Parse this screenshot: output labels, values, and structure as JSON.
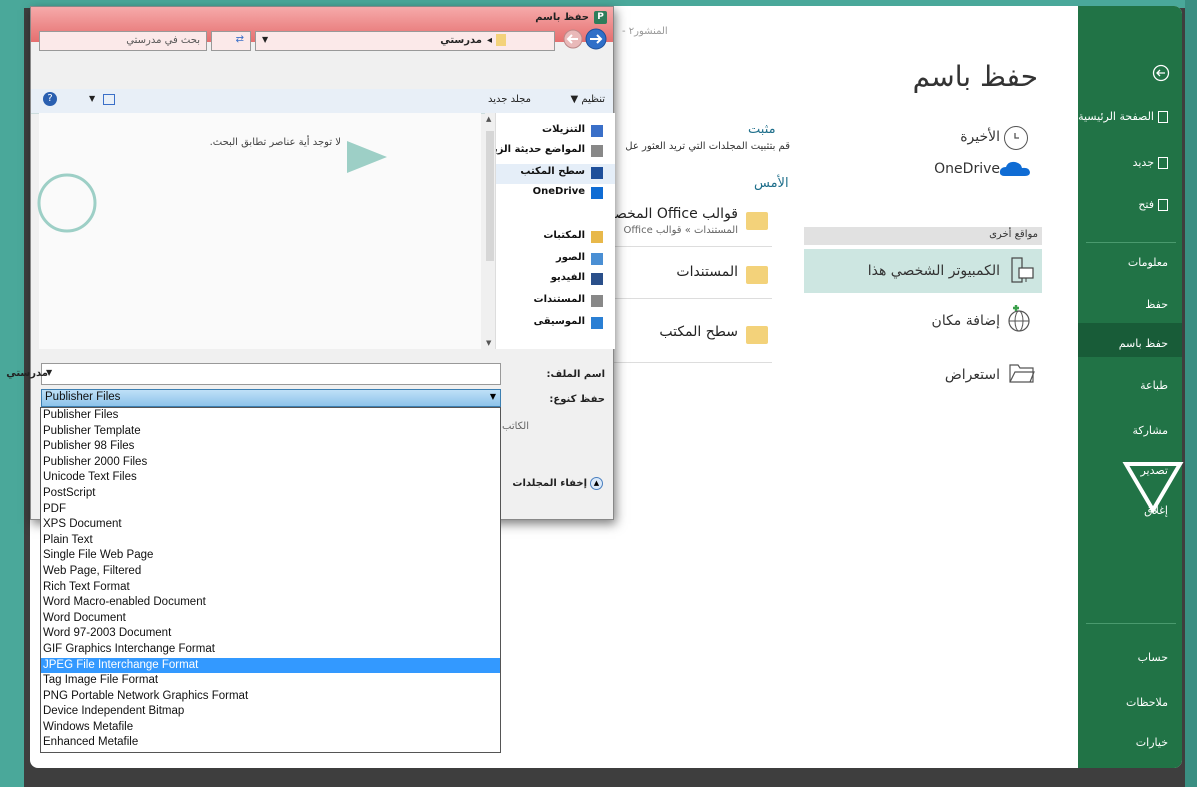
{
  "window": {
    "title_faint": "المنشور٢ -"
  },
  "backstage": {
    "back_icon": "back-arrow-icon",
    "items": [
      {
        "label": "الصفحة الرئيسية",
        "icon": "home-icon"
      },
      {
        "label": "جديد",
        "icon": "new-doc-icon"
      },
      {
        "label": "فتح",
        "icon": "open-folder-icon"
      },
      {
        "label": "معلومات"
      },
      {
        "label": "حفظ"
      },
      {
        "label": "حفظ باسم",
        "selected": true
      },
      {
        "label": "طباعة"
      },
      {
        "label": "مشاركة"
      },
      {
        "label": "تصدير"
      },
      {
        "label": "إغلاق"
      },
      {
        "label": "حساب"
      },
      {
        "label": "ملاحظات"
      },
      {
        "label": "خيارات"
      }
    ]
  },
  "saveas": {
    "title": "حفظ باسم",
    "locations": [
      {
        "label": "الأخيرة",
        "icon": "clock-icon"
      },
      {
        "label": "OneDrive",
        "icon": "onedrive-cloud-icon"
      }
    ],
    "other_locations_header": "مواقع أخرى",
    "other": [
      {
        "label": "الكمبيوتر الشخصي هذا",
        "icon": "pc-icon",
        "selected": true
      },
      {
        "label": "إضافة مكان",
        "icon": "add-place-icon"
      },
      {
        "label": "استعراض",
        "icon": "browse-folder-icon"
      }
    ],
    "pinned_title": "مثبت",
    "pinned_desc": "قم بتثبيت المجلدات التي تريد العثور عل",
    "yesterday": "الأمس",
    "folders": [
      {
        "name": "قوالب Office المخصصة",
        "path": "المستندات » قوالب Office"
      },
      {
        "name": "المستندات",
        "path": ""
      },
      {
        "name": "سطح المكتب",
        "path": ""
      }
    ]
  },
  "dialog": {
    "title": "حفظ باسم",
    "address": "مدرستي",
    "search_placeholder": "بحث في مدرستي",
    "organize": "تنظيم ▼",
    "new_folder": "مجلد جديد",
    "nav": [
      {
        "label": "التنزيلات",
        "icon": "downloads-icon"
      },
      {
        "label": "المواضع حديثة الزيا",
        "icon": "recent-places-icon"
      },
      {
        "label": "سطح المكتب",
        "icon": "desktop-icon",
        "selected": true
      },
      {
        "label": "OneDrive",
        "icon": "onedrive-icon"
      },
      {
        "label": "المكتبات",
        "icon": "libraries-icon"
      },
      {
        "label": "الصور",
        "icon": "pictures-icon"
      },
      {
        "label": "الفيديو",
        "icon": "video-icon"
      },
      {
        "label": "المستندات",
        "icon": "documents-icon"
      },
      {
        "label": "الموسيقى",
        "icon": "music-icon"
      }
    ],
    "empty_msg": "لا توجد أية عناصر تطابق البحث.",
    "filename_label": "اسم الملف:",
    "filename_value": "مدرستي",
    "savetype_label": "حفظ كنوع:",
    "savetype_value": "Publisher Files",
    "author_label": "الكاتب:",
    "hide_folders": "إخفاء المجلدات",
    "types": [
      "Publisher Files",
      "Publisher Template",
      "Publisher 98 Files",
      "Publisher 2000 Files",
      "Unicode Text Files",
      "PostScript",
      "PDF",
      "XPS Document",
      "Plain Text",
      "Single File Web Page",
      "Web Page, Filtered",
      "Rich Text Format",
      "Word Macro-enabled Document",
      "Word Document",
      "Word 97-2003 Document",
      "GIF Graphics Interchange Format",
      "JPEG File Interchange Format",
      "Tag Image File Format",
      "PNG Portable Network Graphics Format",
      "Device Independent Bitmap",
      "Windows Metafile",
      "Enhanced Metafile"
    ],
    "selected_type": "JPEG File Interchange Format"
  }
}
